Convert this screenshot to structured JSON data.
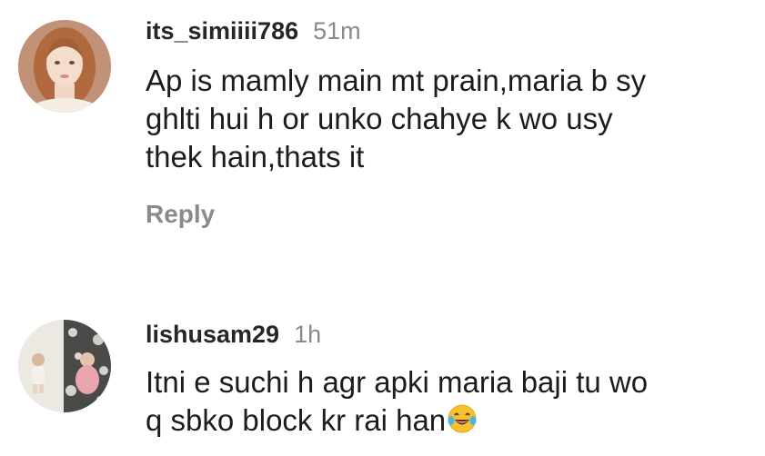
{
  "comments": [
    {
      "username": "its_simiiii786",
      "time": "51m",
      "lines": [
        "Ap is mamly main mt prain,maria b sy",
        "ghlti hui h or unko chahye k wo usy",
        "thek hain,thats it"
      ],
      "reply_label": "Reply"
    },
    {
      "username": "lishusam29",
      "time": "1h",
      "lines": [
        "Itni e suchi h agr apki maria baji tu wo",
        "q sbko block kr rai han"
      ],
      "emoji": "face-with-tears-of-joy"
    }
  ]
}
